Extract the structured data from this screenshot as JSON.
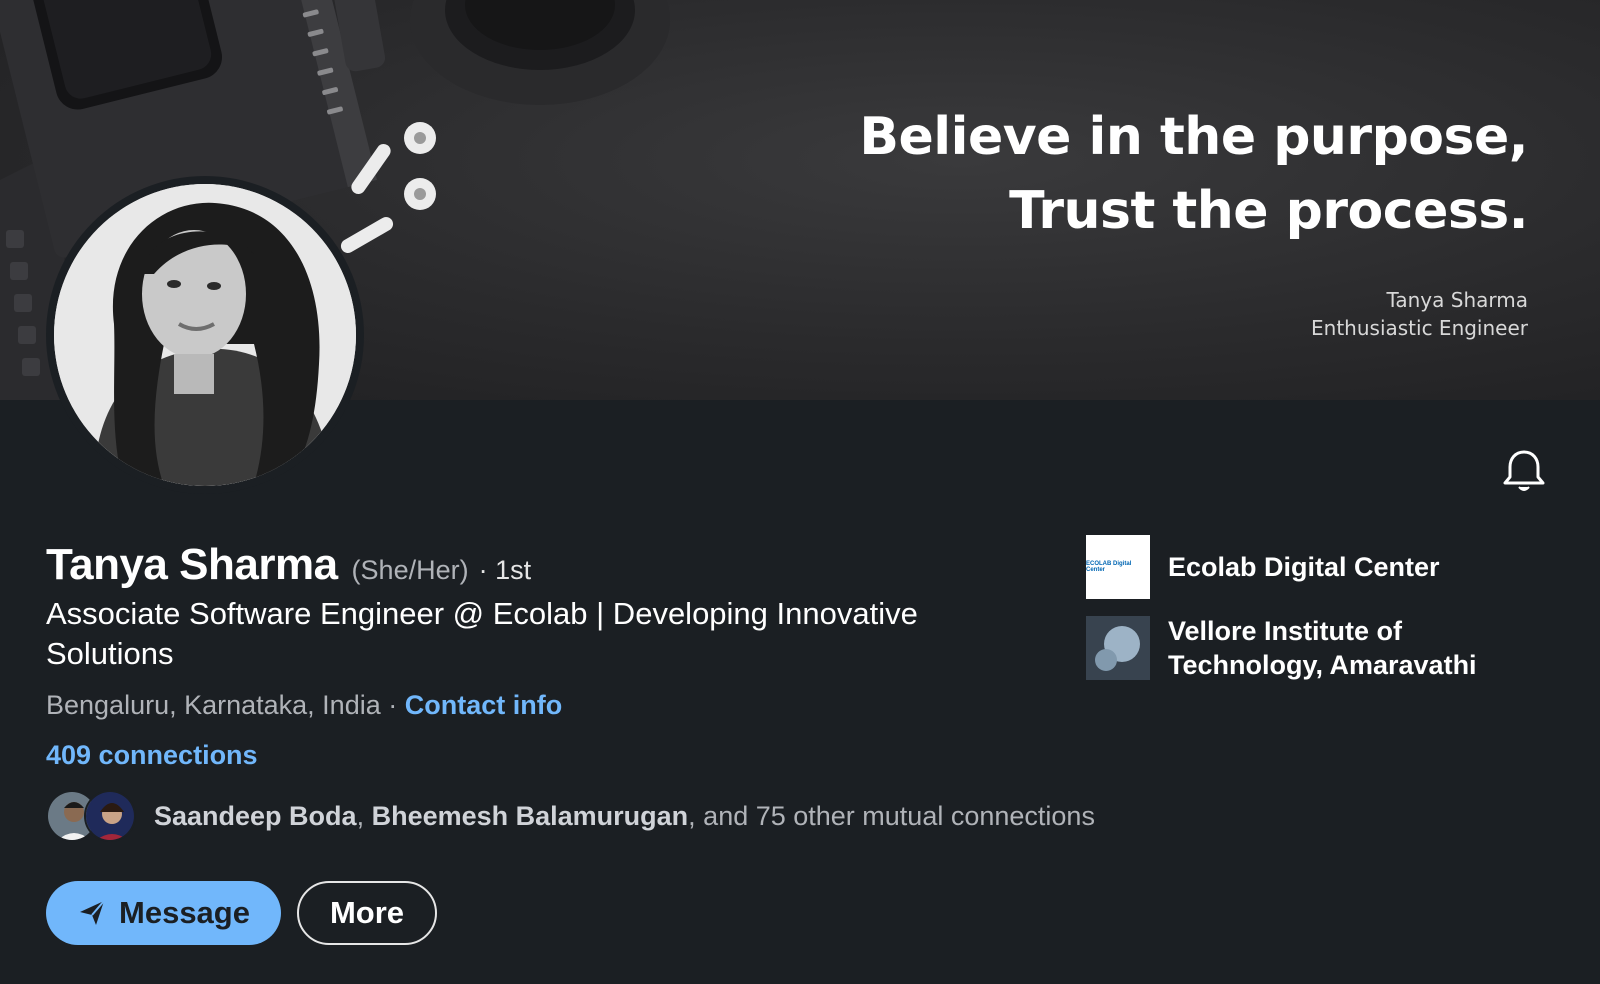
{
  "banner": {
    "quote_line1": "Believe in the purpose,",
    "quote_line2": "Trust the process.",
    "signature_name": "Tanya Sharma",
    "signature_title": "Enthusiastic Engineer"
  },
  "profile": {
    "name": "Tanya Sharma",
    "pronouns": "(She/Her)",
    "degree": "· 1st",
    "headline": "Associate Software Engineer @ Ecolab | Developing Innovative Solutions",
    "location": "Bengaluru, Karnataka, India",
    "location_sep": " · ",
    "contact_info": "Contact info",
    "connections": "409 connections",
    "mutual": {
      "name1": "Saandeep Boda",
      "sep": ", ",
      "name2": "Bheemesh Balamurugan",
      "rest": ", and 75 other mutual connections"
    }
  },
  "actions": {
    "message_label": "Message",
    "more_label": "More"
  },
  "organizations": [
    {
      "name": "Ecolab Digital Center",
      "logo_text": "ECOLAB Digital Center"
    },
    {
      "name": "Vellore Institute of Technology, Amaravathi"
    }
  ],
  "icons": {
    "bell": "bell-icon",
    "message": "send-icon"
  },
  "colors": {
    "background": "#1b1f23",
    "link": "#71b7fb",
    "muted": "#b0b3b8",
    "primary_button": "#71b7fb"
  }
}
